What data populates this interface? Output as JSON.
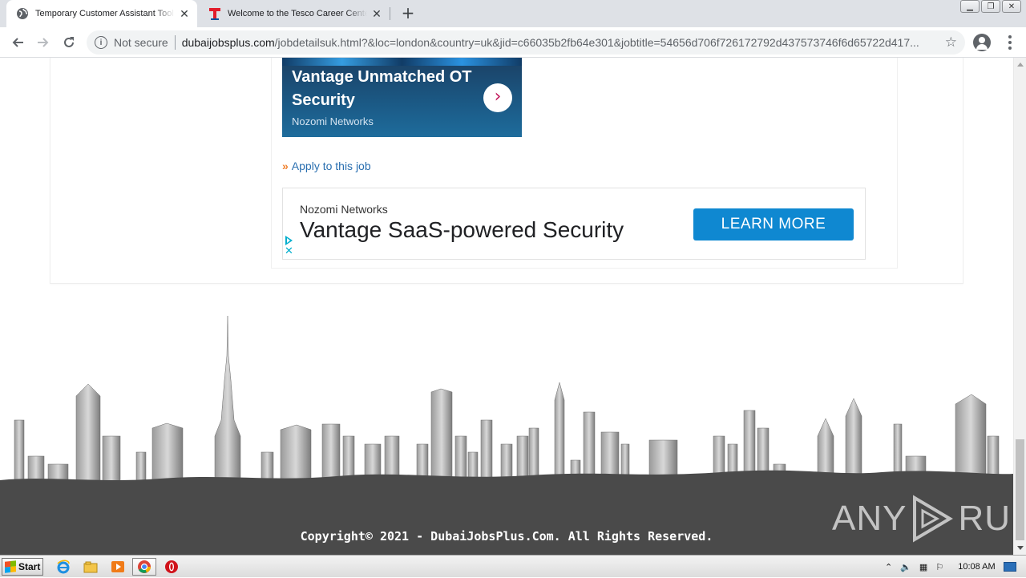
{
  "browser": {
    "tabs": [
      {
        "title": "Temporary Customer Assistant Tool",
        "active": true
      },
      {
        "title": "Welcome to the Tesco Career Cente",
        "active": false
      }
    ],
    "new_tab_label": "+",
    "address": {
      "security_label": "Not secure",
      "host": "dubaijobsplus.com",
      "path": "/jobdetailsuk.html?&loc=london&country=uk&jid=c66035b2fb64e301&jobtitle=54656d706f726172792d437573746f6d65722d417..."
    }
  },
  "page": {
    "ad_top": {
      "headline": "Vantage Unmatched OT Security",
      "brand": "Nozomi Networks"
    },
    "apply_link": "Apply to this job",
    "ad_banner": {
      "advertiser": "Nozomi Networks",
      "headline": "Vantage SaaS-powered Security",
      "cta": "LEARN MORE"
    },
    "footer": {
      "copyright": "Copyright© 2021 - DubaiJobsPlus.Com. All Rights Reserved."
    },
    "watermark": {
      "left": "ANY",
      "right": "RUN"
    }
  },
  "taskbar": {
    "start_label": "Start",
    "clock": "10:08 AM"
  },
  "colors": {
    "link": "#2a6fb0",
    "cta": "#0f88d1",
    "footer_bg": "#4a4a4a",
    "ad_accent": "#c2185b"
  }
}
